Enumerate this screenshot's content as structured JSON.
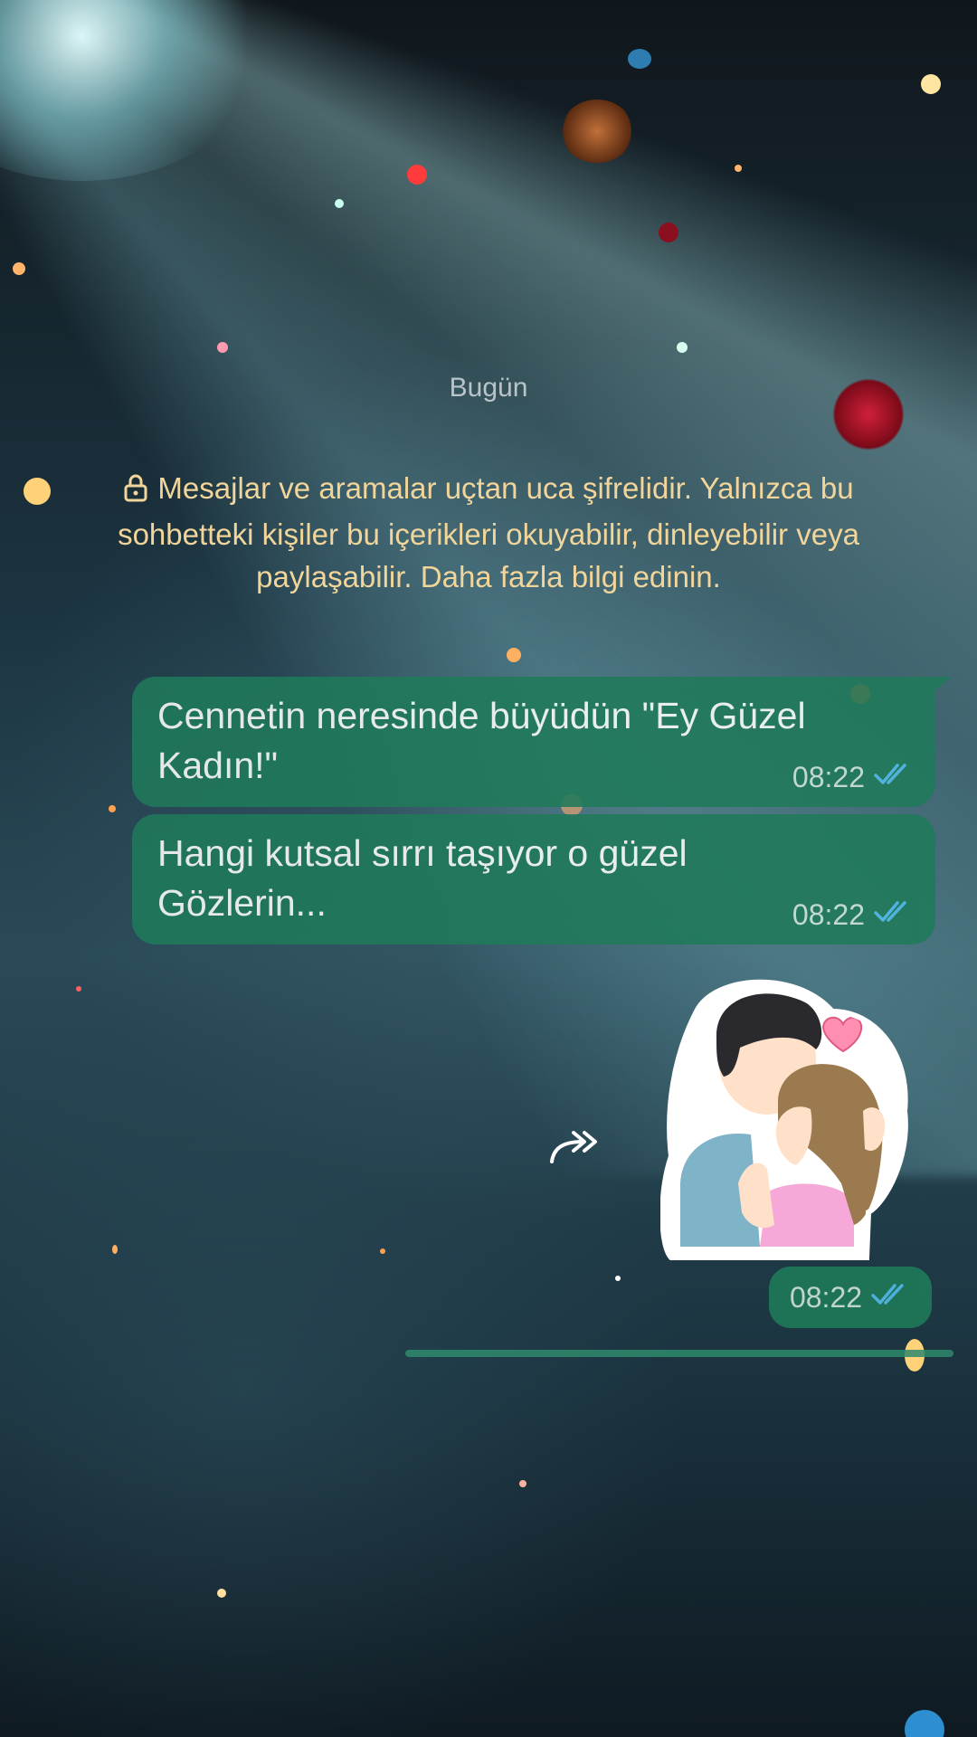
{
  "chat": {
    "date_label": "Bugün",
    "encryption_notice": "Mesajlar ve aramalar uçtan uca şifrelidir. Yalnızca bu sohbetteki kişiler bu içerikleri okuyabilir, dinleyebilir veya paylaşabilir. Daha fazla bilgi edinin.",
    "messages": [
      {
        "text": "Cennetin neresinde büyüdün \"Ey Güzel Kadın!\"",
        "time": "08:22",
        "status": "read-double-check"
      },
      {
        "text": "Hangi kutsal sırrı taşıyor o güzel Gözlerin...",
        "time": "08:22",
        "status": "read-double-check"
      }
    ],
    "sticker_message": {
      "time": "08:22",
      "status": "read-double-check",
      "sticker": "couple-hug-sticker"
    }
  },
  "colors": {
    "outgoing_bubble": "#1f7a5a",
    "read_ticks": "#53bdeb",
    "notice_text": "#f1d59a",
    "date_text": "#b9c4c9"
  },
  "icons": [
    "lock-icon",
    "double-check-icon",
    "forward-icon"
  ]
}
